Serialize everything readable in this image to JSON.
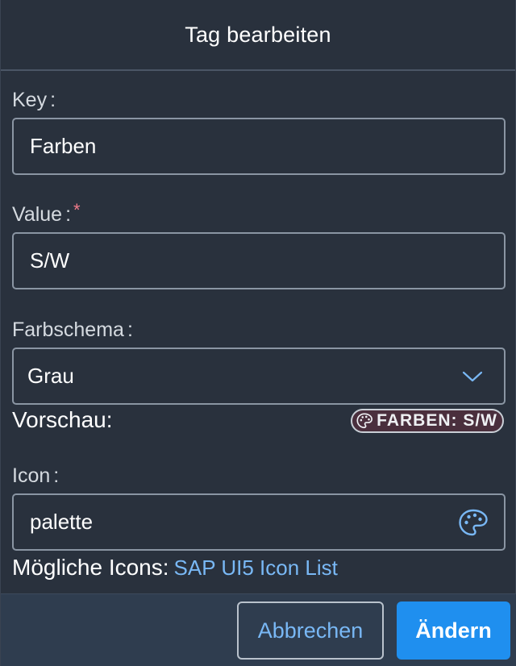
{
  "dialog": {
    "title": "Tag bearbeiten"
  },
  "form": {
    "key": {
      "label": "Key",
      "colon": ":",
      "value": "Farben"
    },
    "value": {
      "label": "Value",
      "colon": ":",
      "required_mark": "*",
      "value": "S/W"
    },
    "color_scheme": {
      "label": "Farbschema",
      "colon": ":",
      "selected": "Grau"
    },
    "preview": {
      "label": "Vorschau:",
      "tag_text": "FARBEN: S/W",
      "tag_icon": "palette-icon"
    },
    "icon": {
      "label": "Icon",
      "colon": ":",
      "value": "palette",
      "icon": "palette-icon"
    },
    "hint": {
      "text": "Mögliche Icons:",
      "link_text": "SAP UI5 Icon List"
    }
  },
  "footer": {
    "cancel_label": "Abbrechen",
    "submit_label": "Ändern"
  },
  "colors": {
    "background": "#29313d",
    "footer": "#2f3d4f",
    "primary": "#1f8fef",
    "link": "#79b8f5",
    "required": "#f07b8a"
  }
}
